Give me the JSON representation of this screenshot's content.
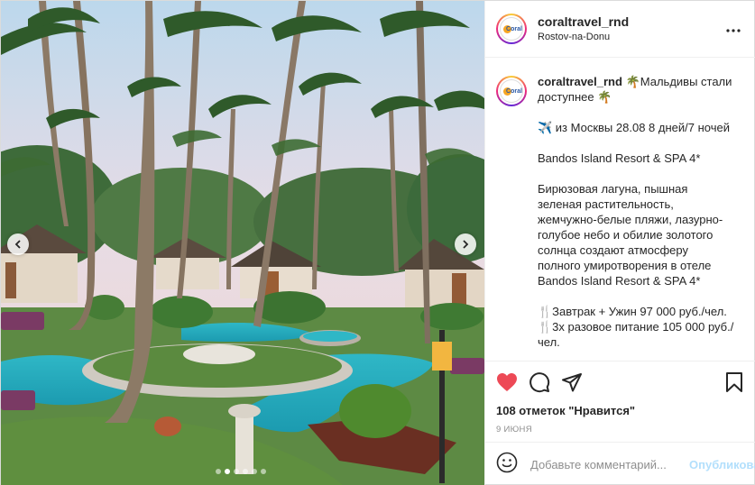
{
  "post": {
    "username": "coraltravel_rnd",
    "location": "Rostov-na-Donu",
    "avatar_text": "Coral"
  },
  "caption": {
    "username": "coraltravel_rnd",
    "text": "🌴Мальдивы стали доступнее 🌴\n\n✈️ из Москвы 28.08 8 дней/7 ночей\n\nBandos Island Resort & SPA 4*\n\nБирюзовая лагуна, пышная зеленая растительность, жемчужно-белые пляжи, лазурно-голубое небо и обилие золотого солнца создают атмосферу полного умиротворения в отеле Bandos Island Resort & SPA 4*\n\n🍴Завтрак + Ужин 97 000 руб./чел.\n🍴3х разовое питание 105 000 руб./чел.\n\n*За подробной информацией"
  },
  "engagement": {
    "likes": "108 отметок \"Нравится\"",
    "date": "9 ИЮНЯ"
  },
  "comment_box": {
    "placeholder": "Добавьте комментарий...",
    "publish_label": "Опубликовать"
  },
  "carousel": {
    "slide_count": 6,
    "active_index": 1
  },
  "colors": {
    "like_red": "#ed4956",
    "publish_disabled": "#b2dffc",
    "secondary_text": "#8e8e8e"
  },
  "icons": {
    "more": "more-options-icon",
    "like": "heart-icon",
    "comment": "comment-icon",
    "share": "share-icon",
    "save": "bookmark-icon",
    "emoji": "emoji-icon",
    "prev": "chevron-left-icon",
    "next": "chevron-right-icon"
  }
}
